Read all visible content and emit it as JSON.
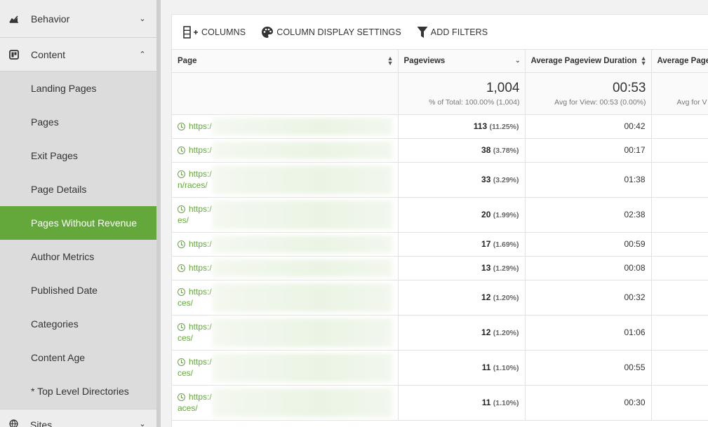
{
  "sidebar": {
    "behavior": "Behavior",
    "content": "Content",
    "items": [
      {
        "label": "Landing Pages"
      },
      {
        "label": "Pages"
      },
      {
        "label": "Exit Pages"
      },
      {
        "label": "Page Details"
      },
      {
        "label": "Pages Without Revenue"
      },
      {
        "label": "Author Metrics"
      },
      {
        "label": "Published Date"
      },
      {
        "label": "Categories"
      },
      {
        "label": "Content Age"
      },
      {
        "label": "* Top Level Directories"
      }
    ],
    "sites": "Sites"
  },
  "toolbar": {
    "columns": "COLUMNS",
    "display_settings": "COLUMN DISPLAY SETTINGS",
    "add_filters": "ADD FILTERS"
  },
  "table": {
    "headers": [
      "Page",
      "Pageviews",
      "Average Pageview Duration",
      "Average Page"
    ],
    "summary": {
      "pageviews": "1,004",
      "pageviews_sub": "% of Total: 100.00% (1,004)",
      "duration": "00:53",
      "duration_sub": "Avg for View: 00:53 (0.00%)",
      "cut_sub": "Avg for V"
    },
    "rows": [
      {
        "url": "https:/",
        "url2": "",
        "views": "113",
        "pct": "(11.25%)",
        "dur": "00:42"
      },
      {
        "url": "https:/",
        "url2": "",
        "views": "38",
        "pct": "(3.78%)",
        "dur": "00:17"
      },
      {
        "url": "https:/",
        "url2": "n/races/",
        "views": "33",
        "pct": "(3.29%)",
        "dur": "01:38"
      },
      {
        "url": "https:/",
        "url2": "es/",
        "views": "20",
        "pct": "(1.99%)",
        "dur": "02:38"
      },
      {
        "url": "https:/",
        "url2": "",
        "views": "17",
        "pct": "(1.69%)",
        "dur": "00:59"
      },
      {
        "url": "https:/",
        "url2": "",
        "views": "13",
        "pct": "(1.29%)",
        "dur": "00:08"
      },
      {
        "url": "https:/",
        "url2": "ces/",
        "views": "12",
        "pct": "(1.20%)",
        "dur": "00:32"
      },
      {
        "url": "https:/",
        "url2": "ces/",
        "views": "12",
        "pct": "(1.20%)",
        "dur": "01:06"
      },
      {
        "url": "https:/",
        "url2": "ces/",
        "views": "11",
        "pct": "(1.10%)",
        "dur": "00:55"
      },
      {
        "url": "https:/",
        "url2": "aces/",
        "views": "11",
        "pct": "(1.10%)",
        "dur": "00:30"
      }
    ]
  },
  "colors": {
    "accent": "#64a83b"
  }
}
